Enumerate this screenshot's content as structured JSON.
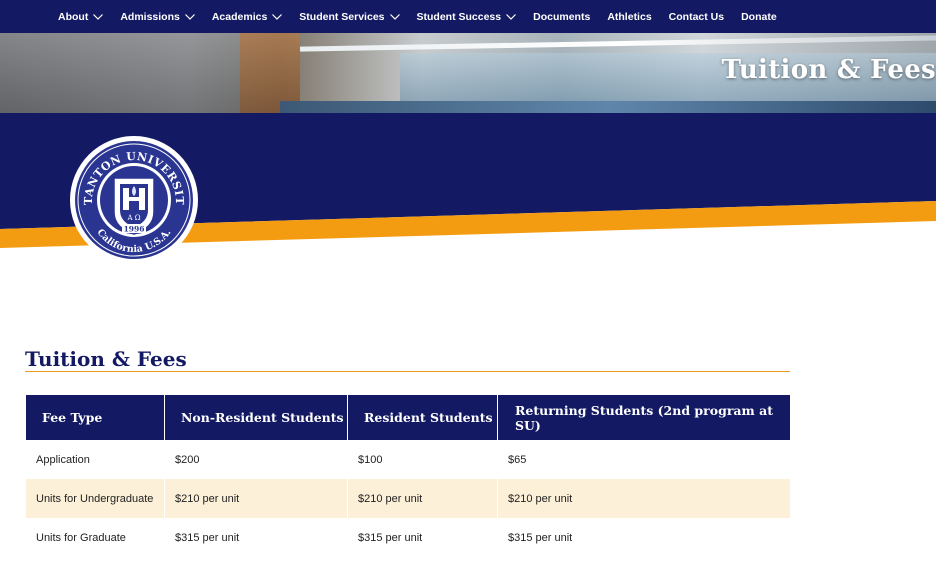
{
  "nav": {
    "items": [
      {
        "label": "About",
        "dropdown": true
      },
      {
        "label": "Admissions",
        "dropdown": true
      },
      {
        "label": "Academics",
        "dropdown": true
      },
      {
        "label": "Student Services",
        "dropdown": true
      },
      {
        "label": "Student Success",
        "dropdown": true
      },
      {
        "label": "Documents",
        "dropdown": false
      },
      {
        "label": "Athletics",
        "dropdown": false
      },
      {
        "label": "Contact Us",
        "dropdown": false
      },
      {
        "label": "Donate",
        "dropdown": false
      }
    ]
  },
  "hero": {
    "title": "Tuition & Fees"
  },
  "seal": {
    "top_text": "STANTON UNIVERSITY",
    "bottom_text": "California U.S.A.",
    "year": "1996",
    "letters": "A Ω"
  },
  "section": {
    "title": "Tuition & Fees"
  },
  "table": {
    "headers": [
      "Fee Type",
      "Non-Resident Students",
      "Resident Students",
      "Returning Students (2nd program at SU)"
    ],
    "rows": [
      [
        "Application",
        "$200",
        "$100",
        "$65"
      ],
      [
        "Units for Undergraduate",
        "$210 per unit",
        "$210 per unit",
        "$210 per unit"
      ],
      [
        "Units for Graduate",
        "$315 per unit",
        "$315 per unit",
        "$315 per unit"
      ]
    ]
  },
  "colors": {
    "navy": "#131a63",
    "gold": "#f39c12",
    "row_alt": "#fdf0d8",
    "rule": "#e89c1f"
  }
}
